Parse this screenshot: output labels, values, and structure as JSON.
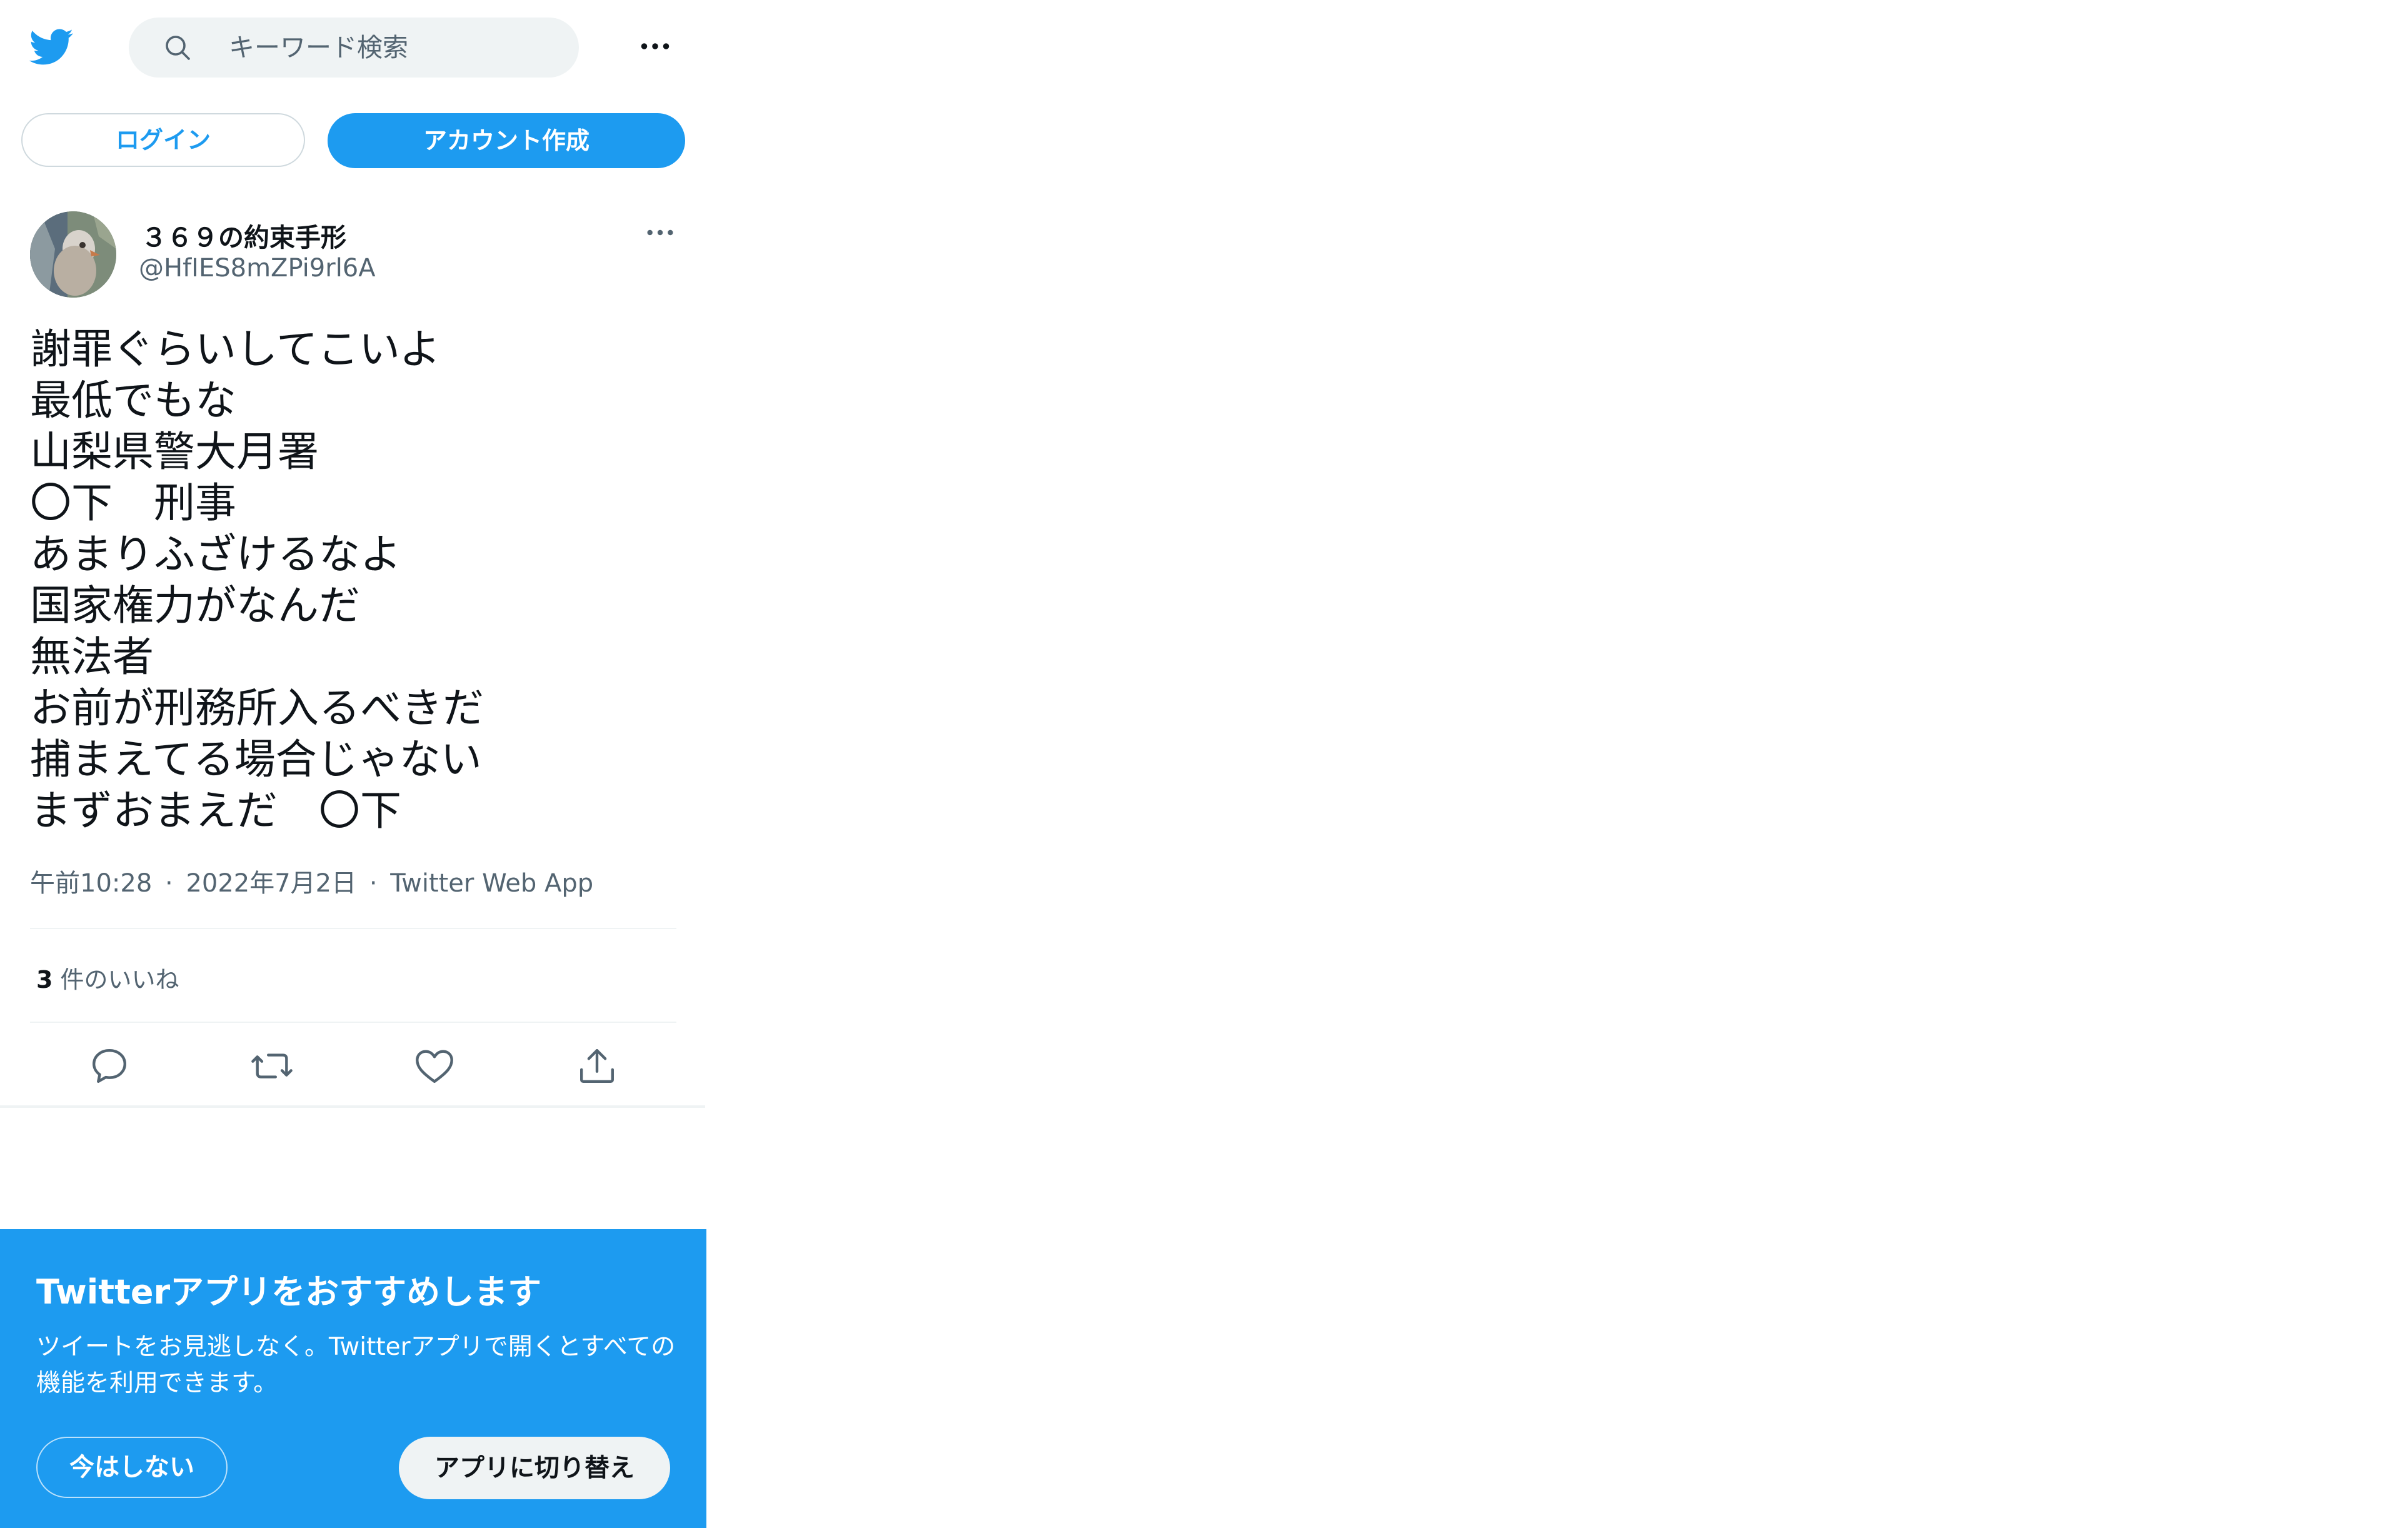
{
  "colors": {
    "brand": "#1d9bf0",
    "text_primary": "#0f1419",
    "text_secondary": "#536471",
    "surface": "#eff3f4"
  },
  "header": {
    "logo_icon": "twitter-bird-icon",
    "search_placeholder": "キーワード検索",
    "more_icon": "more-horizontal-icon"
  },
  "auth": {
    "login_label": "ログイン",
    "signup_label": "アカウント作成"
  },
  "tweet": {
    "author_name": "３６９の約束手形",
    "author_handle": "@HfIES8mZPi9rl6A",
    "text": "謝罪ぐらいしてこいよ\n最低でもな\n山梨県警大月署\n〇下　刑事\nあまりふざけるなよ\n国家権力がなんだ\n無法者\nお前が刑務所入るべきだ\n捕まえてる場合じゃない\nまずおまえだ　〇下",
    "time": "午前10:28",
    "date": "2022年7月2日",
    "source": "Twitter Web App",
    "separator": "·",
    "likes_count": "3",
    "likes_label": "件のいいね",
    "actions": [
      "reply-icon",
      "retweet-icon",
      "like-icon",
      "share-icon"
    ]
  },
  "app_promo": {
    "title": "Twitterアプリをおすすめします",
    "description": "ツイートをお見逃しなく。Twitterアプリで開くとすべての機能を利用できます。",
    "not_now_label": "今はしない",
    "switch_label": "アプリに切り替え"
  }
}
